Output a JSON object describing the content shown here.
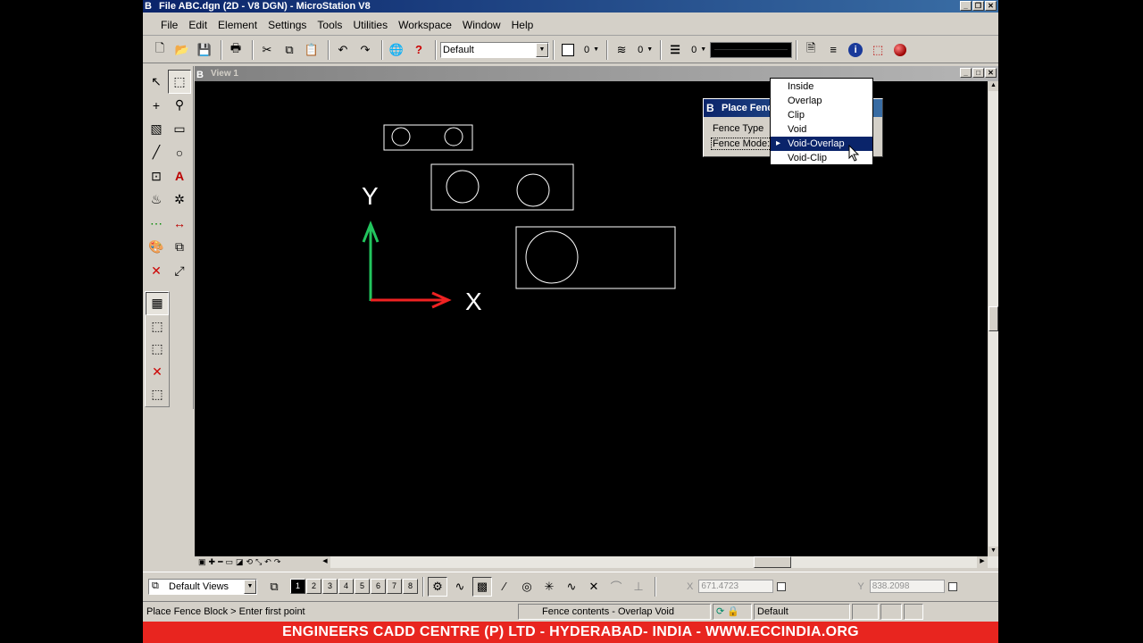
{
  "window": {
    "title": "File ABC.dgn (2D - V8 DGN) - MicroStation V8",
    "logo": "B"
  },
  "menu": [
    "File",
    "Edit",
    "Element",
    "Settings",
    "Tools",
    "Utilities",
    "Workspace",
    "Window",
    "Help"
  ],
  "toolbar": {
    "level_value": "Default",
    "color_value": "0",
    "style_value": "0",
    "weight_value": "0"
  },
  "view": {
    "title": "View 1",
    "axis_y": "Y",
    "axis_x": "X"
  },
  "place_fence": {
    "title": "Place Fence",
    "fence_type_label": "Fence Type",
    "fence_mode_label": "Fence Mode:"
  },
  "fence_mode_options": [
    {
      "label": "Inside"
    },
    {
      "label": "Overlap"
    },
    {
      "label": "Clip"
    },
    {
      "label": "Void"
    },
    {
      "label": "Void-Overlap"
    },
    {
      "label": "Void-Clip"
    }
  ],
  "fence_mode_selected": "Void-Overlap",
  "bottom": {
    "views_combo": "Default Views",
    "view_numbers": [
      "1",
      "2",
      "3",
      "4",
      "5",
      "6",
      "7",
      "8"
    ],
    "x_label": "X",
    "x_value": "671.4723",
    "y_label": "Y",
    "y_value": "838.2098"
  },
  "status": {
    "prompt": "Place Fence Block > Enter first point",
    "message": "Fence contents - Overlap Void",
    "level": "Default"
  },
  "banner": "ENGINEERS CADD CENTRE (P) LTD - HYDERABAD- INDIA - WWW.ECCINDIA.ORG",
  "colors": {
    "axis_y": "#22c55e",
    "axis_x": "#ef2222",
    "banner": "#e8251f",
    "title_bar": "#0a246a",
    "selection": "#0a246a"
  }
}
